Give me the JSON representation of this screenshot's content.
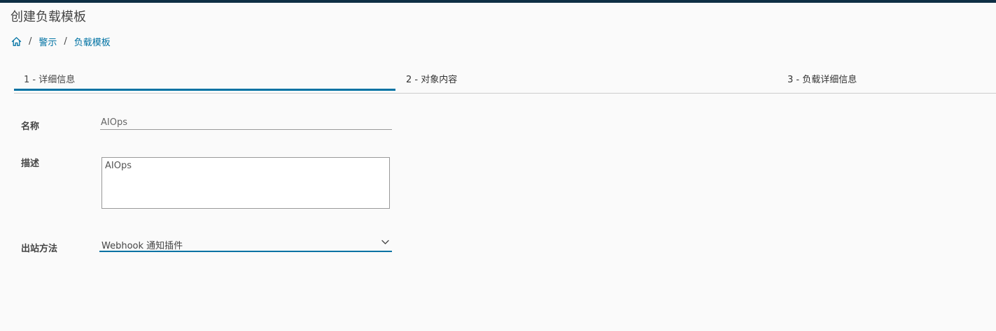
{
  "page": {
    "title": "创建负载模板"
  },
  "breadcrumb": {
    "items": [
      "警示",
      "负载模板"
    ],
    "separator": "/"
  },
  "tabs": [
    {
      "label": "1 - 详细信息",
      "active": true
    },
    {
      "label": "2 - 对象内容",
      "active": false
    },
    {
      "label": "3 - 负载详细信息",
      "active": false
    }
  ],
  "form": {
    "name": {
      "label": "名称",
      "value": "AIOps"
    },
    "description": {
      "label": "描述",
      "value": "AIOps"
    },
    "outbound_method": {
      "label": "出站方法",
      "selected": "Webhook 通知插件"
    }
  },
  "colors": {
    "accent": "#0072a3",
    "top_bar": "#0e2f44",
    "background": "#fafafa"
  },
  "icons": {
    "home": "home-icon",
    "dropdown": "chevron-down-icon"
  }
}
